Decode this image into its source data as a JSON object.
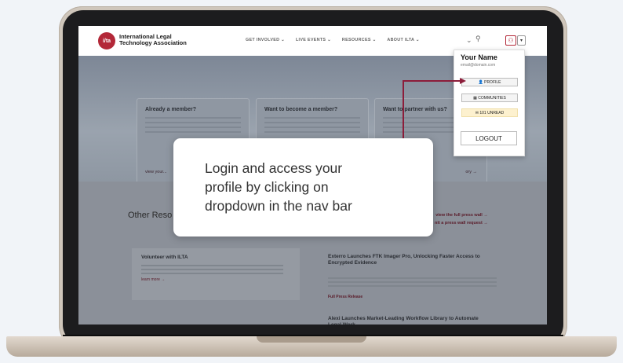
{
  "site": {
    "logo_text": "i/ta",
    "brand_line1": "International Legal",
    "brand_line2": "Technology Association"
  },
  "nav": {
    "links": [
      "GET INVOLVED ⌄",
      "LIVE EVENTS ⌄",
      "RESOURCES ⌄",
      "ABOUT ILTA ⌄"
    ],
    "icons": [
      "chevron-down-icon",
      "search-icon",
      "user-icon",
      "caret-down-icon"
    ]
  },
  "hero": {
    "cards": [
      {
        "title": "Already a member?",
        "link": "view your..."
      },
      {
        "title": "Want to become a member?",
        "link": ""
      },
      {
        "title": "Want to partner with us?",
        "link": "ory →"
      }
    ]
  },
  "dropdown": {
    "name": "Your Name",
    "email": "email@domain.com",
    "profile": "PROFILE",
    "communities": "COMMUNITIES",
    "unread": "101 UNREAD",
    "logout": "LOGOUT"
  },
  "resources": {
    "heading": "Other Reso",
    "press_line1": "view the full press wall →",
    "press_line2": "nit a press wall request →",
    "volunteer_title": "Volunteer with ILTA",
    "volunteer_link": "learn more →",
    "news1_title": "Exterro Launches FTK Imager Pro, Unlocking Faster Access to Encrypted Evidence",
    "news1_link": "Full Press Release",
    "news2_title": "Alexi Launches Market-Leading Workflow Library to Automate Legal Work"
  },
  "callout": {
    "line1": "Login and access your",
    "line2": "profile by clicking on",
    "line3": "dropdown in the nav bar"
  },
  "colors": {
    "accent": "#b32838",
    "connector": "#8c1d3a"
  }
}
